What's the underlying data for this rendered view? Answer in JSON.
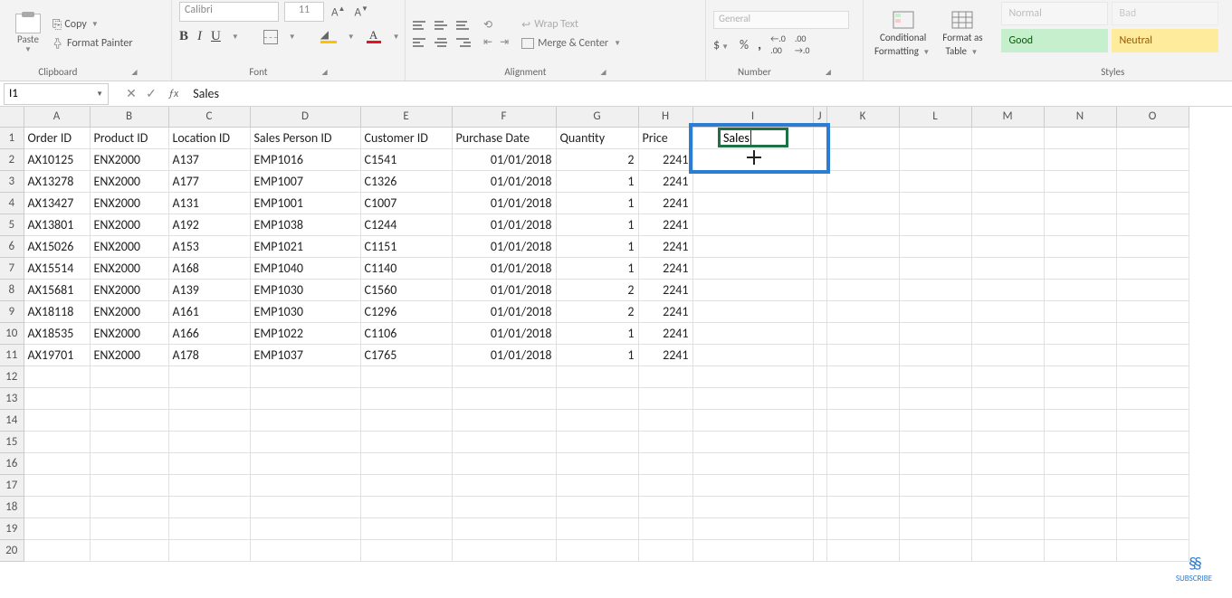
{
  "ribbon": {
    "clipboard": {
      "label": "Clipboard",
      "paste": "Paste",
      "copy": "Copy",
      "painter": "Format Painter"
    },
    "font": {
      "label": "Font",
      "name": "Calibri",
      "size": "11",
      "bold": "B",
      "italic": "I",
      "underline": "U",
      "fontA": "A"
    },
    "alignment": {
      "label": "Alignment",
      "wrap": "Wrap Text",
      "merge": "Merge & Center"
    },
    "number": {
      "label": "Number",
      "format": "General",
      "pct": "%",
      "comma": ",",
      "inc": ".0",
      "dec": ".00"
    },
    "styles": {
      "label": "Styles",
      "cond": "Conditional",
      "cond2": "Formatting",
      "table": "Format as",
      "table2": "Table",
      "normal": "Normal",
      "bad": "Bad",
      "good": "Good",
      "neutral": "Neutral"
    }
  },
  "namebox": "I1",
  "formula": "Sales",
  "columns": [
    "A",
    "B",
    "C",
    "D",
    "E",
    "F",
    "G",
    "H",
    "I",
    "J",
    "K",
    "L",
    "M",
    "N",
    "O"
  ],
  "headers": [
    "Order ID",
    "Product ID",
    "Location ID",
    "Sales Person ID",
    "Customer ID",
    "Purchase Date",
    "Quantity",
    "Price",
    "Sales"
  ],
  "active_cell_text": "Sales",
  "rows": [
    {
      "r": 2,
      "a": "AX10125",
      "b": "ENX2000",
      "c": "A137",
      "d": "EMP1016",
      "e": "C1541",
      "f": "01/01/2018",
      "g": "2",
      "h": "2241"
    },
    {
      "r": 3,
      "a": "AX13278",
      "b": "ENX2000",
      "c": "A177",
      "d": "EMP1007",
      "e": "C1326",
      "f": "01/01/2018",
      "g": "1",
      "h": "2241"
    },
    {
      "r": 4,
      "a": "AX13427",
      "b": "ENX2000",
      "c": "A131",
      "d": "EMP1001",
      "e": "C1007",
      "f": "01/01/2018",
      "g": "1",
      "h": "2241"
    },
    {
      "r": 5,
      "a": "AX13801",
      "b": "ENX2000",
      "c": "A192",
      "d": "EMP1038",
      "e": "C1244",
      "f": "01/01/2018",
      "g": "1",
      "h": "2241"
    },
    {
      "r": 6,
      "a": "AX15026",
      "b": "ENX2000",
      "c": "A153",
      "d": "EMP1021",
      "e": "C1151",
      "f": "01/01/2018",
      "g": "1",
      "h": "2241"
    },
    {
      "r": 7,
      "a": "AX15514",
      "b": "ENX2000",
      "c": "A168",
      "d": "EMP1040",
      "e": "C1140",
      "f": "01/01/2018",
      "g": "1",
      "h": "2241"
    },
    {
      "r": 8,
      "a": "AX15681",
      "b": "ENX2000",
      "c": "A139",
      "d": "EMP1030",
      "e": "C1560",
      "f": "01/01/2018",
      "g": "2",
      "h": "2241"
    },
    {
      "r": 9,
      "a": "AX18118",
      "b": "ENX2000",
      "c": "A161",
      "d": "EMP1030",
      "e": "C1296",
      "f": "01/01/2018",
      "g": "2",
      "h": "2241"
    },
    {
      "r": 10,
      "a": "AX18535",
      "b": "ENX2000",
      "c": "A166",
      "d": "EMP1022",
      "e": "C1106",
      "f": "01/01/2018",
      "g": "1",
      "h": "2241"
    },
    {
      "r": 11,
      "a": "AX19701",
      "b": "ENX2000",
      "c": "A178",
      "d": "EMP1037",
      "e": "C1765",
      "f": "01/01/2018",
      "g": "1",
      "h": "2241"
    }
  ],
  "empty_rows": [
    12,
    13,
    14,
    15,
    16,
    17,
    18,
    19,
    20
  ],
  "subscribe": "SUBSCRIBE"
}
